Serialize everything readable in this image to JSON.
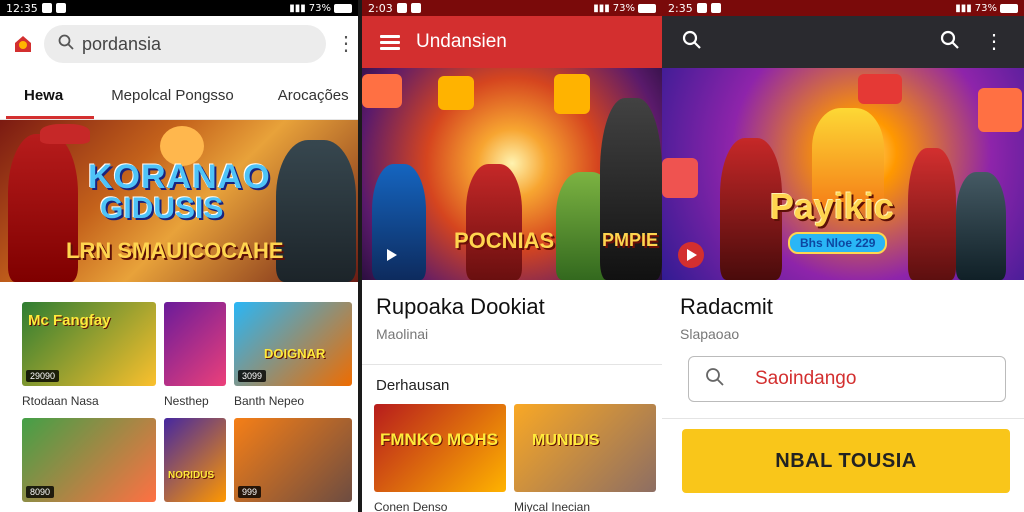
{
  "panel1": {
    "status": {
      "time": "12:35",
      "right": "73%"
    },
    "search": {
      "value": "pordansia"
    },
    "tabs": [
      {
        "label": "Hewa"
      },
      {
        "label": "Mepolcal Pongsso"
      },
      {
        "label": "Arocações"
      }
    ],
    "hero": {
      "line1": "KORANAO",
      "line2": "GIDUSIS",
      "line3": "LRN SMAUICOCAHE"
    },
    "cards": [
      {
        "title": "Mc Fangfay",
        "badge": "29090",
        "caption": "Rtodaan Nasa",
        "colors": [
          "#2e7d32",
          "#fbc02d"
        ]
      },
      {
        "title": "",
        "badge": "",
        "caption": "Nesthep",
        "colors": [
          "#6a1b9a",
          "#ec407a"
        ]
      },
      {
        "title": "DOIGNAR",
        "badge": "3099",
        "caption": "Banth Nepeo",
        "colors": [
          "#29b6f6",
          "#ef6c00"
        ]
      },
      {
        "title": "",
        "badge": "8090",
        "caption": "",
        "colors": [
          "#43a047",
          "#ff7043"
        ]
      },
      {
        "title": "NORIDUS",
        "badge": "",
        "caption": "",
        "colors": [
          "#4527a0",
          "#ff9800"
        ]
      },
      {
        "title": "",
        "badge": "999",
        "caption": "",
        "colors": [
          "#f57f17",
          "#6d4c41"
        ]
      }
    ]
  },
  "panel2": {
    "status": {
      "time": "2:03",
      "right": "73%"
    },
    "title": "Undansien",
    "hero": {
      "text": "POCNIAS",
      "text2": "PMPIE"
    },
    "app_title": "Rupoaka Dookiat",
    "app_sub": "Maolinai",
    "section": "Derhausan",
    "cards": [
      {
        "title": "FMNKO MOHS",
        "caption": "Conen Denso",
        "colors": [
          "#b71c1c",
          "#ffb300"
        ]
      },
      {
        "title": "MUNIDIS",
        "caption": "Miycal Inecian",
        "colors": [
          "#f9a825",
          "#8d6e63"
        ]
      }
    ]
  },
  "panel3": {
    "status": {
      "time": "2:35",
      "right": "73%"
    },
    "hero": {
      "text": "Payikic",
      "pill": "Bhs Nloe 229"
    },
    "app_title": "Radacmit",
    "app_sub": "Slapaoao",
    "search": {
      "value": "Saoindango"
    },
    "cta": "NBAL TOUSIA"
  }
}
